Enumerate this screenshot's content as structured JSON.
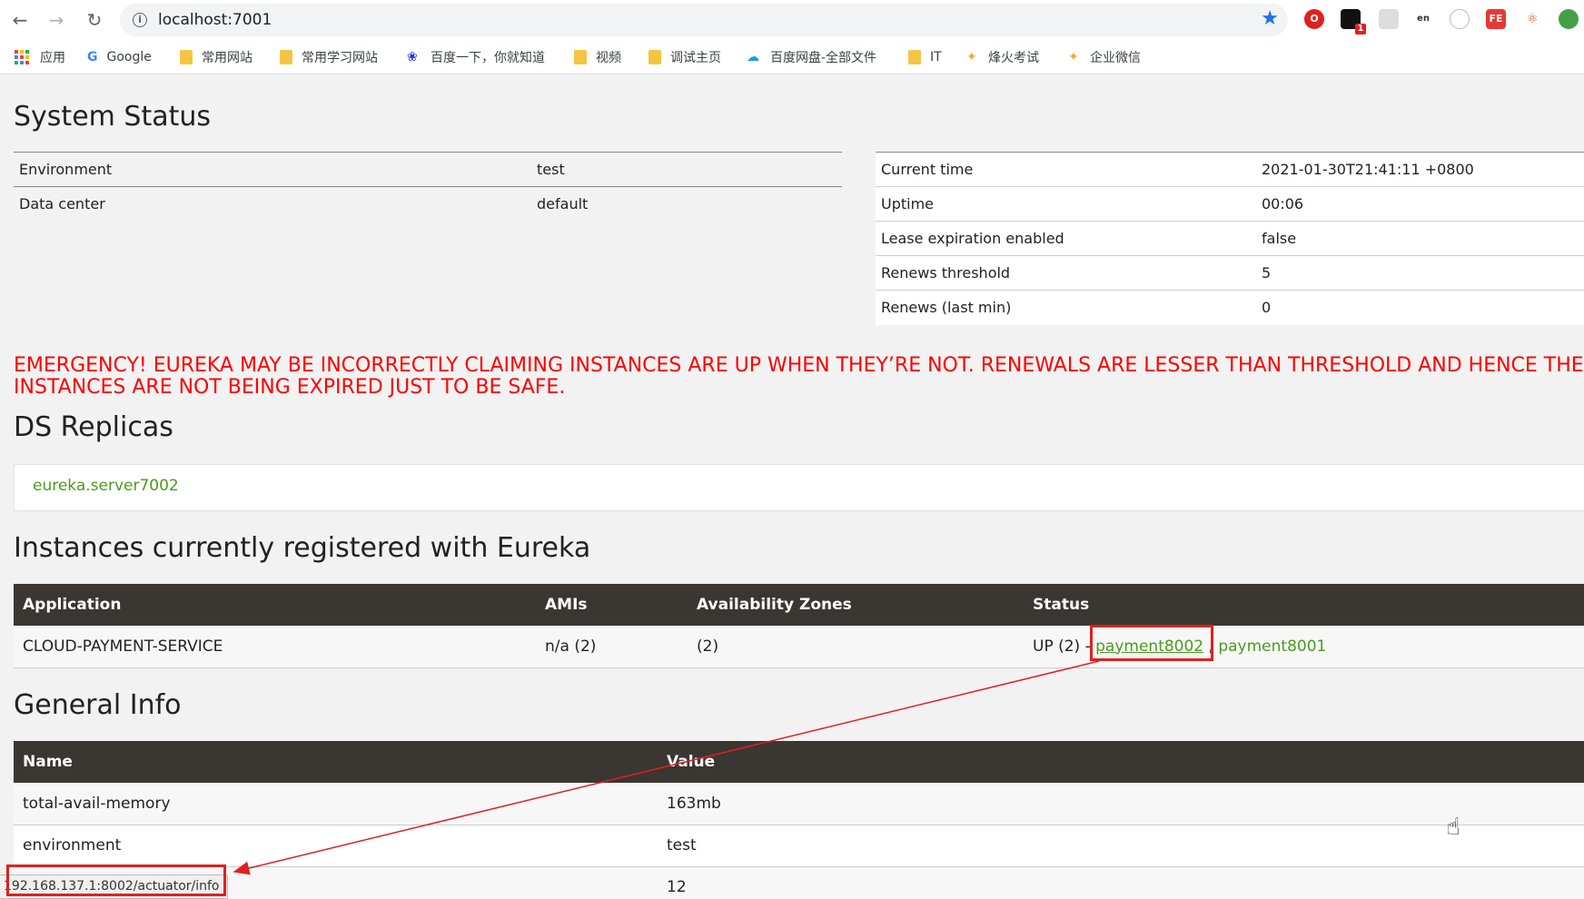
{
  "browser": {
    "url": "localhost:7001",
    "bookmarks": [
      "应用",
      "Google",
      "常用网站",
      "常用学习网站",
      "百度一下，你就知道",
      "视频",
      "调试主页",
      "百度网盘-全部文件",
      "IT",
      "烽火考试",
      "企业微信"
    ],
    "extension_badge": "1",
    "status_url": "192.168.137.1:8002/actuator/info"
  },
  "system_status": {
    "title": "System Status",
    "left": [
      {
        "key": "Environment",
        "value": "test"
      },
      {
        "key": "Data center",
        "value": "default"
      }
    ],
    "right": [
      {
        "key": "Current time",
        "value": "2021-01-30T21:41:11 +0800"
      },
      {
        "key": "Uptime",
        "value": "00:06"
      },
      {
        "key": "Lease expiration enabled",
        "value": "false"
      },
      {
        "key": "Renews threshold",
        "value": "5"
      },
      {
        "key": "Renews (last min)",
        "value": "0"
      }
    ]
  },
  "emergency": "EMERGENCY! EUREKA MAY BE INCORRECTLY CLAIMING INSTANCES ARE UP WHEN THEY’RE NOT. RENEWALS ARE LESSER THAN THRESHOLD AND HENCE THE INSTANCES ARE NOT BEING EXPIRED JUST TO BE SAFE.",
  "ds_replicas": {
    "title": "DS Replicas",
    "items": [
      "eureka.server7002"
    ]
  },
  "instances": {
    "title": "Instances currently registered with Eureka",
    "headers": [
      "Application",
      "AMIs",
      "Availability Zones",
      "Status"
    ],
    "rows": [
      {
        "application": "CLOUD-PAYMENT-SERVICE",
        "amis": "n/a (2)",
        "zones": "(2)",
        "status_prefix": "UP (2) -",
        "instances": [
          "payment8002",
          "payment8001"
        ]
      }
    ]
  },
  "general_info": {
    "title": "General Info",
    "headers": [
      "Name",
      "Value"
    ],
    "rows": [
      {
        "name": "total-avail-memory",
        "value": "163mb"
      },
      {
        "name": "environment",
        "value": "test"
      },
      {
        "name": "",
        "value": "12"
      }
    ]
  },
  "colors": {
    "emergency": "#ff0000",
    "link": "#4a9b1f",
    "table_header": "#3a3632",
    "highlight": "#e02020"
  }
}
